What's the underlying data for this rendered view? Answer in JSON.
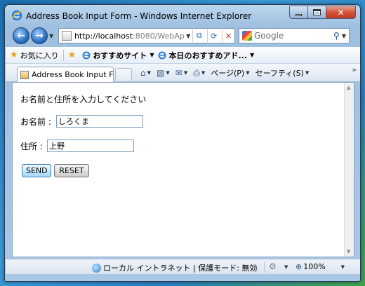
{
  "window": {
    "title": "Address Book Input Form - Windows Internet Explorer"
  },
  "nav": {
    "url_host": "http://localhost",
    "url_rest": ":8080/WebApplic",
    "search_placeholder": "Google"
  },
  "favorites": {
    "favorites_label": "お気に入り",
    "suggested_sites": "おすすめサイト",
    "daily_picks": "本日のおすすめアド..."
  },
  "tabs": [
    {
      "label": "Address Book Input F..."
    }
  ],
  "command_bar": {
    "page_menu": "ページ(P)",
    "safety_menu": "セーフティ(S)"
  },
  "form": {
    "prompt": "お名前と住所を入力してください",
    "name_label": "お名前 :",
    "name_value": "しろくま",
    "address_label": "住所 :",
    "address_value": "上野",
    "send_label": "SEND",
    "reset_label": "RESET"
  },
  "status": {
    "zone_text": "ローカル イントラネット | 保護モード: 無効",
    "zoom": "100%"
  }
}
